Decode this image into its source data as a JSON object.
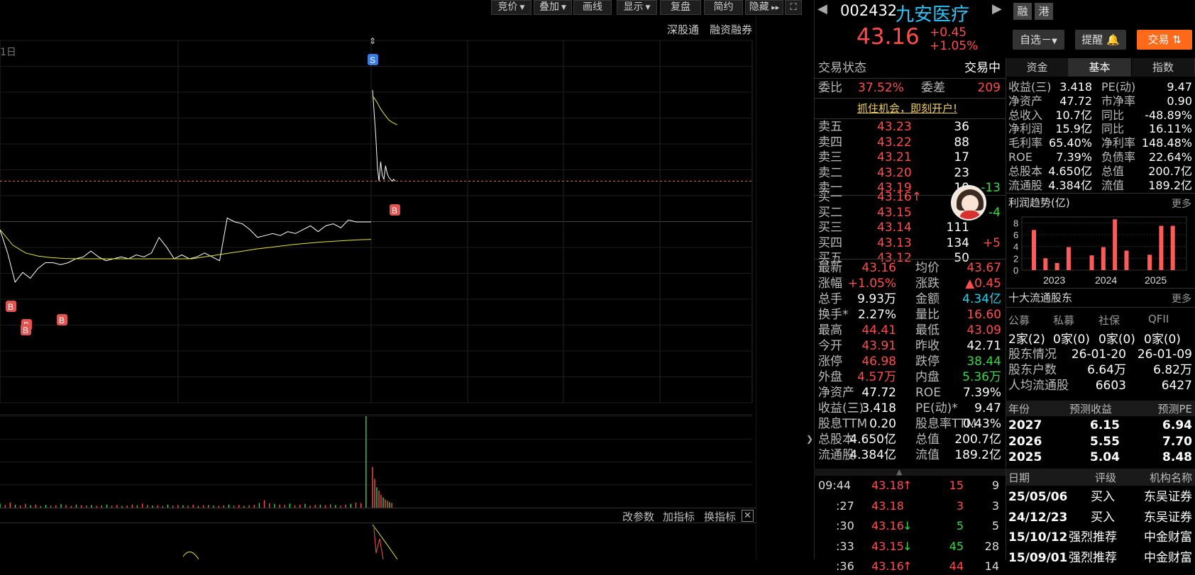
{
  "toolbar": {
    "items": [
      {
        "label": "竞价",
        "dropdown": true
      },
      {
        "label": "叠加",
        "dropdown": true
      },
      {
        "label": "画线",
        "dropdown": false
      },
      {
        "label": "显示",
        "dropdown": true
      },
      {
        "label": "复盘",
        "dropdown": false
      },
      {
        "label": "简约",
        "dropdown": false
      },
      {
        "label": "隐藏",
        "dropdown": false
      }
    ],
    "shengu": "深股通",
    "rongzi": "融资融券",
    "date_fragment": "1日"
  },
  "chart_data": [
    {
      "type": "line",
      "title": "",
      "x_range": [
        "09:25",
        "15:00"
      ],
      "pct_axis_right": [
        "4.66%",
        "3.99%",
        "3.33%",
        "2.66%",
        "2.00%",
        "1.33%",
        "0.67%",
        "0.00%",
        "0.67%",
        "1.33%",
        "2.00%",
        "2.66%",
        "3.33%",
        "3.99%",
        "4.66%"
      ],
      "pct_axis_color": [
        "red",
        "red",
        "red",
        "red",
        "red",
        "red",
        "red",
        "white",
        "green",
        "green",
        "green",
        "green",
        "green",
        "green",
        "green"
      ],
      "current_pct": "1.05%",
      "series": [
        {
          "name": "price",
          "color": "#ffffff",
          "values_pct": [
            -0.2,
            -0.8,
            -1.55,
            -1.3,
            -1.45,
            -1.2,
            -1.05,
            -1.05,
            -1.1,
            -1.05,
            -0.95,
            -0.9,
            -0.75,
            -0.9,
            -1.0,
            -0.95,
            -0.9,
            -0.95,
            -0.85,
            -0.9,
            -0.8,
            -0.4,
            -0.65,
            -0.95,
            -0.85,
            -0.95,
            -0.9,
            -0.8,
            -0.9,
            -1.0,
            0.1,
            0.0,
            -0.05,
            -0.2,
            -0.4,
            -0.35,
            -0.3,
            -0.35,
            -0.25,
            -0.3,
            -0.2,
            -0.1,
            -0.25,
            -0.1,
            -0.05,
            -0.15,
            0.05,
            0.0,
            0.0,
            0.0
          ]
        },
        {
          "name": "avg",
          "color": "#e6e632",
          "values_pct": [
            -0.2,
            -0.6,
            -0.8,
            -0.88,
            -0.92,
            -0.94,
            -0.95,
            -0.95,
            -0.95,
            -0.95,
            -0.95,
            -0.95,
            -0.95,
            -0.95,
            -0.95,
            -0.95,
            -0.9,
            -0.85,
            -0.8,
            -0.75,
            -0.7,
            -0.66,
            -0.62,
            -0.58,
            -0.55,
            -0.52,
            -0.5,
            -0.48,
            -0.46,
            -0.45
          ]
        }
      ],
      "post_break": {
        "price_pct": [
          3.4,
          2.8,
          2.2,
          1.4,
          1.05,
          1.55,
          1.2,
          1.1,
          1.45,
          1.25,
          1.15,
          1.1,
          1.05,
          1.1,
          1.05
        ],
        "avg_pct": [
          3.25,
          3.1,
          2.9,
          2.75,
          2.62,
          2.55,
          2.5
        ]
      },
      "markers": [
        {
          "label": "S",
          "kind": "sell"
        },
        {
          "label": "B",
          "kind": "buy"
        },
        {
          "label": "B",
          "kind": "buy"
        },
        {
          "label": "B",
          "kind": "buy"
        },
        {
          "label": "B",
          "kind": "buy"
        },
        {
          "label": "B",
          "kind": "buy"
        }
      ]
    },
    {
      "type": "bar",
      "title": "",
      "y_ticks": [
        26925,
        20193,
        13462,
        6731
      ],
      "ylim": [
        0,
        26925
      ],
      "values": [
        1200,
        800,
        1500,
        900,
        600,
        1100,
        700,
        900,
        500,
        800,
        600,
        700,
        1000,
        800,
        500,
        900,
        700,
        600,
        800,
        500,
        700,
        900,
        600,
        800,
        500,
        600,
        900,
        700,
        1200,
        800,
        600,
        700,
        500,
        900,
        600,
        800,
        700,
        600,
        900,
        500,
        700,
        800,
        600,
        500,
        700,
        900,
        600,
        800,
        500,
        700,
        800,
        1400,
        2200,
        1300,
        1100,
        900,
        800,
        1200,
        700,
        900,
        1100,
        600,
        800,
        900,
        700,
        1000,
        800,
        600,
        900,
        1100,
        1500,
        1300,
        26925,
        12000,
        8500,
        6000,
        5000,
        3800,
        3000,
        2400,
        2000,
        1600,
        1400
      ]
    }
  ],
  "indicator_bar": {
    "params": "改参数",
    "add": "加指标",
    "swap": "换指标"
  },
  "header": {
    "code": "002432",
    "name": "九安医疗",
    "tag_rong": "融",
    "tag_gang": "港",
    "price": "43.16",
    "change": "+0.45",
    "change_pct": "+1.05%",
    "btn_zixuan": "自选",
    "btn_tixing": "提醒",
    "btn_jiaoyi": "交易"
  },
  "status": {
    "label": "交易状态",
    "value": "交易中"
  },
  "weibi": {
    "label": "委比",
    "value": "37.52%",
    "label2": "委差",
    "value2": "209"
  },
  "promo": "抓住机会，即刻开户!",
  "asks": [
    {
      "label": "卖五",
      "price": "43.23",
      "vol": "36",
      "delta": ""
    },
    {
      "label": "卖四",
      "price": "43.22",
      "vol": "88",
      "delta": ""
    },
    {
      "label": "卖三",
      "price": "43.21",
      "vol": "17",
      "delta": ""
    },
    {
      "label": "卖二",
      "price": "43.20",
      "vol": "23",
      "delta": ""
    },
    {
      "label": "卖一",
      "price": "43.19",
      "vol": "10",
      "delta": "-13"
    }
  ],
  "bids": [
    {
      "label": "买一",
      "price": "43.16↑",
      "vol": "",
      "delta": ""
    },
    {
      "label": "买二",
      "price": "43.15",
      "vol": "",
      "delta": "-4"
    },
    {
      "label": "买三",
      "price": "43.14",
      "vol": "111",
      "delta": ""
    },
    {
      "label": "买四",
      "price": "43.13",
      "vol": "134",
      "delta": "+5"
    },
    {
      "label": "买五",
      "price": "43.12",
      "vol": "50",
      "delta": ""
    }
  ],
  "quote_stats": [
    {
      "l1": "最新",
      "v1": "43.16",
      "c1": "red",
      "l2": "均价",
      "v2": "43.67",
      "c2": "red"
    },
    {
      "l1": "涨幅",
      "v1": "+1.05%",
      "c1": "red",
      "l2": "涨跌",
      "v2": "▲0.45",
      "c2": "red"
    },
    {
      "l1": "总手",
      "v1": "9.93万",
      "c1": "white",
      "l2": "金额",
      "v2": "4.34亿",
      "c2": "cyan"
    },
    {
      "l1": "换手*",
      "v1": "2.27%",
      "c1": "white",
      "l2": "量比",
      "v2": "16.60",
      "c2": "red"
    },
    {
      "l1": "最高",
      "v1": "44.41",
      "c1": "red",
      "l2": "最低",
      "v2": "43.09",
      "c2": "red"
    },
    {
      "l1": "今开",
      "v1": "43.91",
      "c1": "red",
      "l2": "昨收",
      "v2": "42.71",
      "c2": "white"
    },
    {
      "l1": "涨停",
      "v1": "46.98",
      "c1": "red",
      "l2": "跌停",
      "v2": "38.44",
      "c2": "green"
    },
    {
      "l1": "外盘",
      "v1": "4.57万",
      "c1": "red",
      "l2": "内盘",
      "v2": "5.36万",
      "c2": "green"
    },
    {
      "l1": "净资产",
      "v1": "47.72",
      "c1": "white",
      "l2": "ROE",
      "v2": "7.39%",
      "c2": "white"
    },
    {
      "l1": "收益(㆔)",
      "v1": "3.418",
      "c1": "white",
      "l2": "PE(动)*",
      "v2": "9.47",
      "c2": "white"
    },
    {
      "l1": "股息TTM",
      "v1": "0.20",
      "c1": "white",
      "l2": "股息率TTM",
      "v2": "0.43%",
      "c2": "white"
    },
    {
      "l1": "总股本",
      "v1": "4.650亿",
      "c1": "white",
      "l2": "总值",
      "v2": "200.7亿",
      "c2": "white"
    },
    {
      "l1": "流通股",
      "v1": "4.384亿",
      "c1": "white",
      "l2": "流值",
      "v2": "189.2亿",
      "c2": "white"
    }
  ],
  "ticks": [
    {
      "time": "09:44",
      "price": "43.18",
      "dir": "↑",
      "vol": "15",
      "n": "9",
      "dc": "red"
    },
    {
      "time": ":27",
      "price": "43.18",
      "dir": "",
      "vol": "3",
      "n": "3",
      "dc": "red"
    },
    {
      "time": ":30",
      "price": "43.16",
      "dir": "↓",
      "vol": "5",
      "n": "5",
      "dc": "green"
    },
    {
      "time": ":33",
      "price": "43.15",
      "dir": "↓",
      "vol": "45",
      "n": "28",
      "dc": "green"
    },
    {
      "time": ":36",
      "price": "43.16",
      "dir": "↑",
      "vol": "44",
      "n": "14",
      "dc": "red"
    }
  ],
  "tabs": [
    "资金",
    "基本",
    "指数"
  ],
  "fundamentals": [
    {
      "l1": "收益(㆔)",
      "v1": "3.418",
      "l2": "PE(动)",
      "v2": "9.47",
      "c2": "white"
    },
    {
      "l1": "净资产",
      "v1": "47.72",
      "l2": "市净率",
      "v2": "0.90",
      "c2": "white"
    },
    {
      "l1": "总收入",
      "v1": "10.7亿",
      "l2": "同比",
      "v2": "-48.89%",
      "c2": "white"
    },
    {
      "l1": "净利润",
      "v1": "15.9亿",
      "l2": "同比",
      "v2": "16.11%",
      "c2": "white"
    },
    {
      "l1": "毛利率",
      "v1": "65.40%",
      "l2": "净利率",
      "v2": "148.48%",
      "c2": "white"
    },
    {
      "l1": "ROE",
      "v1": "7.39%",
      "l2": "负债率",
      "v2": "22.64%",
      "c2": "white"
    },
    {
      "l1": "总股本",
      "v1": "4.650亿",
      "l2": "总值",
      "v2": "200.7亿",
      "c2": "white"
    },
    {
      "l1": "流通股",
      "v1": "4.384亿",
      "l2": "流值",
      "v2": "189.2亿",
      "c2": "white"
    }
  ],
  "profit": {
    "title": "利润趋势(亿)",
    "more": "更多",
    "chart": {
      "type": "bar",
      "y_ticks": [
        "8",
        "6",
        "4",
        "2",
        "0"
      ],
      "ylim": [
        0,
        9
      ],
      "x_labels": [
        "2023",
        "2024",
        "2025"
      ],
      "values": [
        6.8,
        2.0,
        1.2,
        3.9,
        0,
        2.5,
        3.9,
        8.6,
        3.3,
        0,
        2.6,
        7.5,
        7.5
      ]
    }
  },
  "holders": {
    "title": "十大流通股东",
    "more": "更多",
    "cats": [
      "公募",
      "私募",
      "社保",
      "QFII"
    ],
    "vals": [
      "2家(2)",
      "0家(0)",
      "0家(0)",
      "0家(0)"
    ],
    "rows": [
      {
        "l": "股东情况",
        "a": "26-01-20",
        "b": "26-01-09"
      },
      {
        "l": "股东户数",
        "a": "6.64万",
        "b": "6.82万"
      },
      {
        "l": "人均流通股",
        "a": "6603",
        "b": "6427"
      }
    ]
  },
  "forecast": {
    "headers": [
      "年份",
      "预测收益",
      "预测PE"
    ],
    "rows": [
      {
        "y": "2027",
        "e": "6.15",
        "pe": "6.94"
      },
      {
        "y": "2026",
        "e": "5.55",
        "pe": "7.70"
      },
      {
        "y": "2025",
        "e": "5.04",
        "pe": "8.48"
      }
    ]
  },
  "ratings": {
    "headers": [
      "日期",
      "评级",
      "机构名称"
    ],
    "rows": [
      {
        "d": "25/05/06",
        "r": "买入",
        "o": "东吴证券"
      },
      {
        "d": "24/12/23",
        "r": "买入",
        "o": "东吴证券"
      },
      {
        "d": "15/10/12",
        "r": "强烈推荐",
        "o": "中金财富"
      },
      {
        "d": "15/09/01",
        "r": "强烈推荐",
        "o": "中金财富"
      }
    ]
  },
  "colors": {
    "up": "#ff4d4d",
    "down": "#3bd64a",
    "accent": "#ff6a1a",
    "cyan": "#22d3ee"
  }
}
